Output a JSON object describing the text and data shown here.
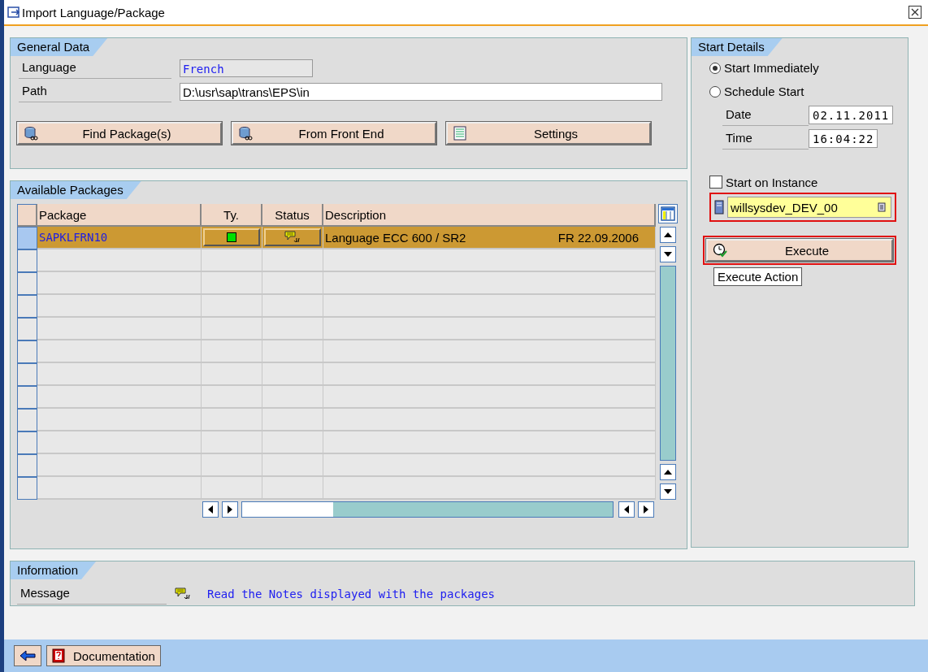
{
  "window": {
    "title": "Import Language/Package"
  },
  "general_data": {
    "title": "General Data",
    "fields": [
      {
        "label": "Language",
        "value": "French",
        "editable": false
      },
      {
        "label": "Path",
        "value": "D:\\usr\\sap\\trans\\EPS\\in",
        "editable": true
      }
    ],
    "buttons": [
      "Find Package(s)",
      "From Front End",
      "Settings"
    ]
  },
  "available_packages": {
    "title": "Available Packages",
    "columns": [
      "Package",
      "Ty.",
      "Status",
      "Description"
    ],
    "rows": [
      {
        "package": "SAPKLFRN10",
        "description": "Language ECC 600 / SR2",
        "date": "FR 22.09.2006",
        "selected": true
      }
    ]
  },
  "start_details": {
    "title": "Start Details",
    "options": [
      {
        "label": "Start Immediately",
        "selected": true
      },
      {
        "label": "Schedule Start",
        "selected": false
      }
    ],
    "date": {
      "label": "Date",
      "value": "02.11.2011"
    },
    "time": {
      "label": "Time",
      "value": "16:04:22"
    },
    "instance": {
      "label": "Start on Instance",
      "checked": false,
      "value": "willsysdev_DEV_00"
    },
    "execute_button": "Execute",
    "tooltip": "Execute Action"
  },
  "information": {
    "title": "Information",
    "label": "Message",
    "message": "Read the Notes displayed with the packages"
  },
  "footer": {
    "documentation_button": "Documentation"
  }
}
